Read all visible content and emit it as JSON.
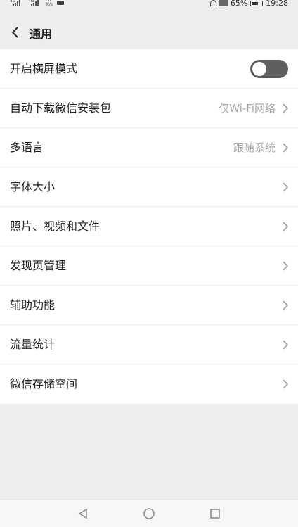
{
  "status_bar": {
    "signal1_label": "4G",
    "signal2_label": "4G",
    "net_speed_value": "0",
    "net_speed_unit": "K/s",
    "battery_percent": "65%",
    "battery_level": 0.65,
    "time": "19:28"
  },
  "header": {
    "title": "通用"
  },
  "settings": [
    {
      "label": "开启横屏模式",
      "type": "toggle",
      "value": "",
      "on": false
    },
    {
      "label": "自动下载微信安装包",
      "type": "link",
      "value": "仅Wi-Fi网络"
    },
    {
      "label": "多语言",
      "type": "link",
      "value": "跟随系统"
    },
    {
      "label": "字体大小",
      "type": "link",
      "value": ""
    },
    {
      "label": "照片、视频和文件",
      "type": "link",
      "value": ""
    },
    {
      "label": "发现页管理",
      "type": "link",
      "value": ""
    },
    {
      "label": "辅助功能",
      "type": "link",
      "value": ""
    },
    {
      "label": "流量统计",
      "type": "link",
      "value": ""
    },
    {
      "label": "微信存储空间",
      "type": "link",
      "value": ""
    }
  ],
  "icons": {
    "back": "chevron-left-icon",
    "row_arrow": "chevron-right-icon",
    "nav_back": "triangle-back-icon",
    "nav_home": "circle-home-icon",
    "nav_recent": "square-recent-icon"
  },
  "colors": {
    "background": "#ededed",
    "row_background": "#ffffff",
    "toggle_off": "#5f5f5f",
    "value_text": "#a6a6a6"
  }
}
